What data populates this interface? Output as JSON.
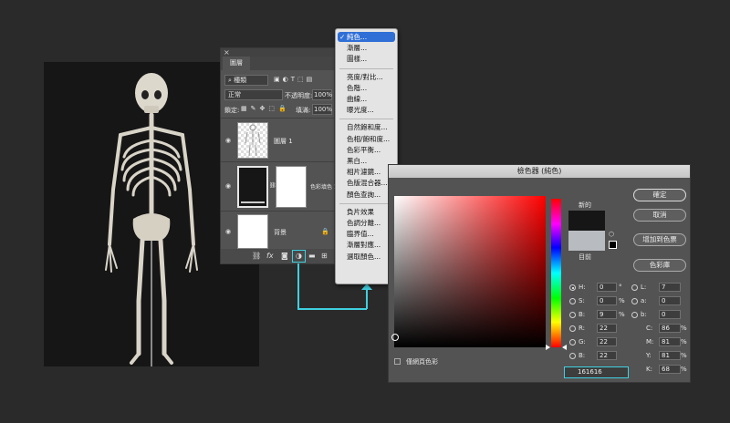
{
  "layers_panel": {
    "close_glyph": "×",
    "tab_label": "圖層",
    "kind_filter": "種類",
    "blend_mode": "正常",
    "opacity_label": "不透明度:",
    "opacity_value": "100%",
    "lock_label": "鎖定:",
    "fill_label": "填滿:",
    "fill_value": "100%",
    "layers": [
      {
        "name": "圖層 1"
      },
      {
        "name": "色彩填色 1"
      },
      {
        "name": "背景"
      }
    ],
    "bottom_icons": [
      "link-icon",
      "fx-icon",
      "mask-icon",
      "adjustment-icon",
      "folder-icon",
      "new-layer-icon",
      "trash-icon"
    ]
  },
  "menu": {
    "items": [
      {
        "label": "純色...",
        "selected": true
      },
      {
        "label": "漸層..."
      },
      {
        "label": "圖樣..."
      },
      {
        "sep": true
      },
      {
        "label": "亮度/對比..."
      },
      {
        "label": "色階..."
      },
      {
        "label": "曲線..."
      },
      {
        "label": "曝光度..."
      },
      {
        "sep": true
      },
      {
        "label": "自然飽和度..."
      },
      {
        "label": "色相/飽和度..."
      },
      {
        "label": "色彩平衡..."
      },
      {
        "label": "黑白..."
      },
      {
        "label": "相片濾鏡..."
      },
      {
        "label": "色版混合器..."
      },
      {
        "label": "顏色查詢..."
      },
      {
        "sep": true
      },
      {
        "label": "負片效果"
      },
      {
        "label": "色調分離..."
      },
      {
        "label": "臨界值..."
      },
      {
        "label": "漸層對應..."
      },
      {
        "label": "選取顏色..."
      }
    ]
  },
  "picker": {
    "title": "檢色器 (純色)",
    "new_label": "新的",
    "current_label": "目前",
    "new_color": "#161616",
    "current_color": "#b8bcc0",
    "buttons": {
      "ok": "確定",
      "cancel": "取消",
      "add_swatch": "增加到色票",
      "libraries": "色彩庫"
    },
    "hsb": [
      {
        "key": "H:",
        "value": "0",
        "unit": "°"
      },
      {
        "key": "S:",
        "value": "0",
        "unit": "%"
      },
      {
        "key": "B:",
        "value": "9",
        "unit": "%"
      }
    ],
    "rgb": [
      {
        "key": "R:",
        "value": "22"
      },
      {
        "key": "G:",
        "value": "22"
      },
      {
        "key": "B:",
        "value": "22"
      }
    ],
    "lab": [
      {
        "key": "L:",
        "value": "7"
      },
      {
        "key": "a:",
        "value": "0"
      },
      {
        "key": "b:",
        "value": "0"
      }
    ],
    "cmyk": [
      {
        "key": "C:",
        "value": "86",
        "unit": "%"
      },
      {
        "key": "M:",
        "value": "81",
        "unit": "%"
      },
      {
        "key": "Y:",
        "value": "81",
        "unit": "%"
      },
      {
        "key": "K:",
        "value": "68",
        "unit": "%"
      }
    ],
    "hex_label": "#",
    "hex_value": "161616",
    "web_only_label": "僅網頁色彩"
  },
  "accent_color": "#3fd0e0"
}
